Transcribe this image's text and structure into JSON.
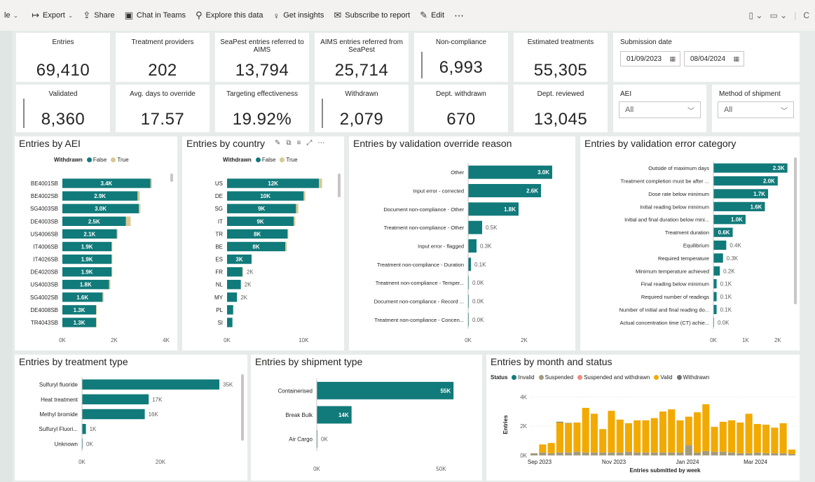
{
  "toolbar": {
    "file_label": "le",
    "items": [
      {
        "icon": "export-icon",
        "glyph": "↦",
        "label": "Export",
        "chevron": true
      },
      {
        "icon": "share-icon",
        "glyph": "⇪",
        "label": "Share"
      },
      {
        "icon": "teams-icon",
        "glyph": "▣",
        "label": "Chat in Teams"
      },
      {
        "icon": "explore-icon",
        "glyph": "⚲",
        "label": "Explore this data"
      },
      {
        "icon": "insights-icon",
        "glyph": "♀",
        "label": "Get insights"
      },
      {
        "icon": "subscribe-icon",
        "glyph": "✉",
        "label": "Subscribe to report"
      },
      {
        "icon": "edit-icon",
        "glyph": "✎",
        "label": "Edit"
      }
    ],
    "more_label": "⋯"
  },
  "cards": {
    "entries": {
      "label": "Entries",
      "value": "69,410"
    },
    "treatment_providers": {
      "label": "Treatment providers",
      "value": "202"
    },
    "seapest_to_aims": {
      "label": "SeaPest entries referred to AIMS",
      "value": "13,794"
    },
    "aims_from_seapest": {
      "label": "AIMS entries referred from SeaPest",
      "value": "25,714"
    },
    "non_compliance": {
      "label": "Non-compliance",
      "value": "6,993"
    },
    "estimated_treatments": {
      "label": "Estimated treatments",
      "value": "55,305"
    },
    "validated": {
      "label": "Validated",
      "value": "8,360"
    },
    "avg_days_override": {
      "label": "Avg. days to override",
      "value": "17.57"
    },
    "targeting_effectiveness": {
      "label": "Targeting effectiveness",
      "value": "19.92%"
    },
    "withdrawn": {
      "label": "Withdrawn",
      "value": "2,079"
    },
    "dept_withdrawn": {
      "label": "Dept. withdrawn",
      "value": "670"
    },
    "dept_reviewed": {
      "label": "Dept. reviewed",
      "value": "13,045"
    }
  },
  "slicers": {
    "submission_date": {
      "label": "Submission date",
      "start": "01/09/2023",
      "end": "08/04/2024"
    },
    "aei": {
      "label": "AEI",
      "value": "All"
    },
    "shipment": {
      "label": "Method of shipment",
      "value": "All"
    }
  },
  "colors": {
    "teal": "#117a7a",
    "tan": "#d9c891",
    "orange": "#f2a900",
    "suspended": "#a39b7d",
    "susp_withdrawn": "#f08a80",
    "withdrawn_gray": "#757575"
  },
  "chart_data": [
    {
      "type": "bar",
      "title": "Entries by AEI",
      "legend_title": "Withdrawn",
      "categories": [
        "BE4001SB",
        "BE4002SB",
        "SG4003SB",
        "DE4003SB",
        "US4006SB",
        "IT4006SB",
        "IT4026SB",
        "DE4020SB",
        "US4003SB",
        "SG4002SB",
        "DE4008SB",
        "TR4043SB"
      ],
      "series": [
        {
          "name": "False",
          "values": [
            3400,
            2900,
            2950,
            2450,
            2100,
            1900,
            1900,
            1900,
            1800,
            1550,
            1300,
            1300
          ]
        },
        {
          "name": "True",
          "values": [
            50,
            80,
            60,
            180,
            30,
            20,
            20,
            10,
            50,
            40,
            30,
            20
          ]
        }
      ],
      "data_labels": [
        "3.4K",
        "2.9K",
        "3.0K",
        "2.5K",
        "2.1K",
        "1.9K",
        "1.9K",
        "1.9K",
        "1.8K",
        "1.6K",
        "1.3K",
        "1.3K"
      ],
      "xlim": [
        0,
        4000
      ],
      "x_ticks": [
        "0K",
        "2K",
        "4K"
      ]
    },
    {
      "type": "bar",
      "title": "Entries by country",
      "legend_title": "Withdrawn",
      "categories": [
        "US",
        "DE",
        "SG",
        "IT",
        "TR",
        "BE",
        "ES",
        "FR",
        "NL",
        "MY",
        "PL",
        "SI"
      ],
      "series": [
        {
          "name": "False",
          "values": [
            12000,
            10000,
            9000,
            8700,
            7900,
            7600,
            3200,
            2000,
            1800,
            1300,
            800,
            700
          ]
        },
        {
          "name": "True",
          "values": [
            400,
            200,
            300,
            200,
            100,
            200,
            0,
            50,
            0,
            0,
            0,
            0
          ]
        }
      ],
      "data_labels": [
        "12K",
        "10K",
        "9K",
        "9K",
        "8K",
        "8K",
        "3K",
        "2K",
        "2K",
        "2K",
        "",
        ""
      ],
      "xlim": [
        0,
        15000
      ],
      "x_ticks": [
        "0K",
        "10K"
      ]
    },
    {
      "type": "bar",
      "title": "Entries by validation override reason",
      "categories": [
        "Other",
        "Input error - corrected",
        "Document non-compliance - Other",
        "Treatment non-compliance - Other",
        "Input error - flagged",
        "Treatment non-compliance - Duration",
        "Treatment non-compliance - Temper...",
        "Document non-compliance - Record ...",
        "Treatment non-compliance - Concen..."
      ],
      "values": [
        3000,
        2600,
        1800,
        500,
        300,
        100,
        10,
        10,
        10
      ],
      "data_labels": [
        "3.0K",
        "2.6K",
        "1.8K",
        "0.5K",
        "0.3K",
        "0.1K",
        "0.0K",
        "0.0K",
        "0.0K"
      ],
      "xlim": [
        0,
        3600
      ],
      "x_ticks": [
        "0K",
        "2K"
      ]
    },
    {
      "type": "bar",
      "title": "Entries by validation error category",
      "categories": [
        "Outside of maximum days",
        "Treatment completion must be after ...",
        "Dose rate below minimum",
        "Initial reading below minimum",
        "Initial and final duration below mini...",
        "Treatment duration",
        "Equilibrium",
        "Required temperature",
        "Minimum temperature achieved",
        "Final reading below minimum",
        "Required number of readings",
        "Number of initial and final reading do...",
        "Actual concentration time (CT) achie..."
      ],
      "values": [
        2300,
        2000,
        1700,
        1600,
        1000,
        600,
        400,
        300,
        200,
        100,
        100,
        100,
        20
      ],
      "data_labels": [
        "2.3K",
        "2.0K",
        "1.7K",
        "1.6K",
        "1.0K",
        "0.6K",
        "0.4K",
        "0.3K",
        "0.2K",
        "0.1K",
        "0.1K",
        "0.1K",
        "0.0K"
      ],
      "xlim": [
        0,
        2700
      ],
      "x_ticks": [
        "0K",
        "1K",
        "2K"
      ]
    },
    {
      "type": "bar",
      "title": "Entries by treatment type",
      "categories": [
        "Sulfuryl fluoride",
        "Heat treatment",
        "Methyl bromide",
        "Sulfuryl Fluori...",
        "Unknown"
      ],
      "values": [
        35000,
        17000,
        16000,
        1000,
        100
      ],
      "data_labels": [
        "35K",
        "17K",
        "16K",
        "1K",
        "0K"
      ],
      "xlim": [
        0,
        40000
      ],
      "x_ticks": [
        "0K",
        "20K"
      ]
    },
    {
      "type": "bar",
      "title": "Entries by shipment type",
      "categories": [
        "Containerised",
        "Break Bulk",
        "Air Cargo"
      ],
      "values": [
        55000,
        14000,
        200
      ],
      "data_labels": [
        "55K",
        "14K",
        "0K"
      ],
      "xlim": [
        0,
        62000
      ],
      "x_ticks": [
        "0K",
        "50K"
      ]
    },
    {
      "type": "bar",
      "stacked": true,
      "title": "Entries by month and status",
      "legend_title": "Status",
      "xlabel": "Entries submitted by week",
      "ylabel": "Entries",
      "x_ticks": [
        "Sep 2023",
        "Nov 2023",
        "Jan 2024",
        "Mar 2024"
      ],
      "y_ticks": [
        "0K",
        "2K",
        "4K"
      ],
      "ylim": [
        0,
        4400
      ],
      "series": [
        {
          "name": "Invalid",
          "values": [
            0,
            0,
            0,
            0,
            0,
            0,
            0,
            0,
            0,
            0,
            0,
            0,
            0,
            0,
            0,
            0,
            0,
            0,
            0,
            0,
            0,
            0,
            0,
            0,
            0,
            0,
            0,
            0,
            0,
            0,
            0
          ]
        },
        {
          "name": "Suspended",
          "values": [
            150,
            200,
            150,
            200,
            200,
            250,
            200,
            200,
            200,
            200,
            200,
            250,
            200,
            200,
            200,
            200,
            200,
            200,
            700,
            200,
            300,
            250,
            250,
            200,
            150,
            150,
            200,
            150,
            150,
            150,
            100
          ]
        },
        {
          "name": "Suspended and withdrawn",
          "values": [
            0,
            0,
            0,
            0,
            0,
            0,
            0,
            0,
            0,
            0,
            0,
            0,
            0,
            0,
            0,
            0,
            0,
            0,
            0,
            0,
            0,
            0,
            0,
            0,
            0,
            0,
            0,
            0,
            0,
            0,
            0
          ]
        },
        {
          "name": "Valid",
          "values": [
            0,
            550,
            700,
            2050,
            2000,
            2000,
            3050,
            2650,
            1600,
            2850,
            2250,
            1950,
            2200,
            2200,
            2350,
            2800,
            2950,
            2200,
            1950,
            2750,
            3200,
            1700,
            2050,
            2200,
            2100,
            2700,
            1950,
            1950,
            1750,
            2050,
            300
          ]
        },
        {
          "name": "Withdrawn",
          "values": [
            0,
            0,
            0,
            50,
            20,
            0,
            0,
            0,
            0,
            0,
            0,
            0,
            0,
            0,
            0,
            0,
            0,
            0,
            0,
            0,
            0,
            0,
            0,
            0,
            0,
            0,
            0,
            0,
            0,
            0,
            0
          ]
        }
      ]
    }
  ]
}
